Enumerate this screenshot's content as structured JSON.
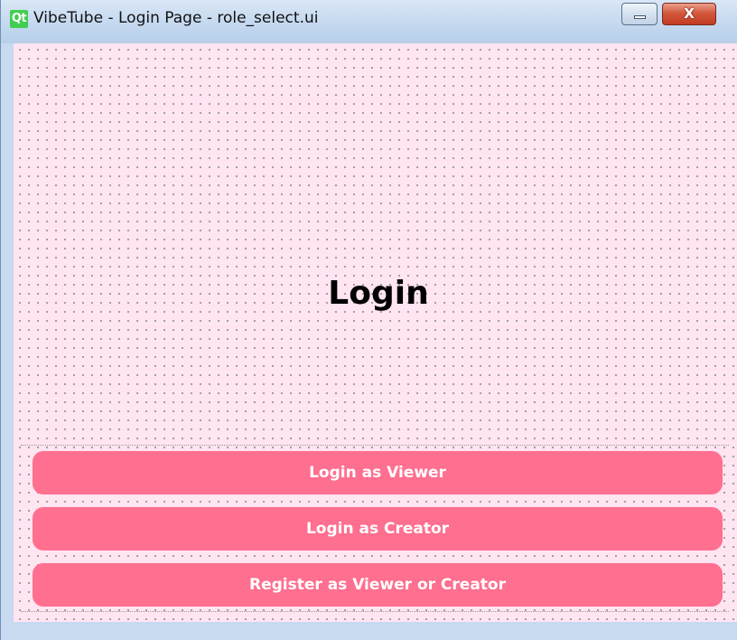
{
  "window": {
    "title": "VibeTube - Login Page - role_select.ui",
    "logo_text": "Qt",
    "close_glyph": "X",
    "minimize_glyph": "",
    "icons": [
      "qt-logo-icon",
      "minimize-icon",
      "close-icon"
    ]
  },
  "main": {
    "heading": "Login",
    "buttons": [
      {
        "label": "Login as Viewer"
      },
      {
        "label": "Login as Creator"
      },
      {
        "label": "Register as Viewer or Creator"
      }
    ]
  },
  "colors": {
    "background": "#ffe4f1",
    "button": "#ff6f8f",
    "button_text": "#ffffff",
    "titlebar": "#c7daf0"
  }
}
